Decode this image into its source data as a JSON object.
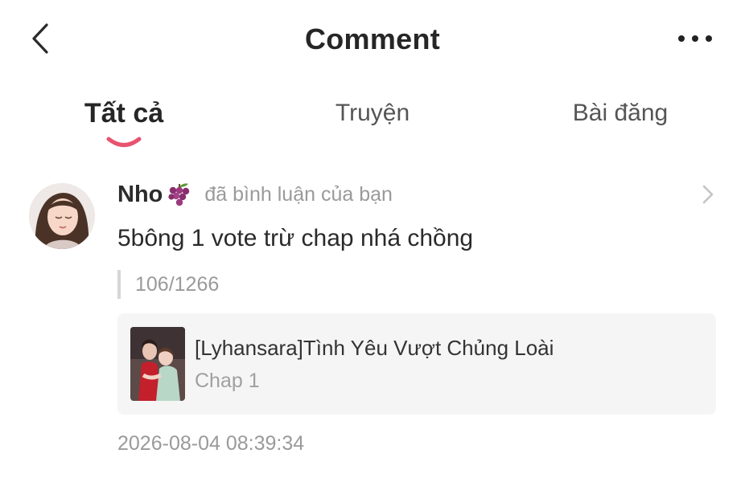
{
  "header": {
    "title": "Comment"
  },
  "tabs": [
    {
      "label": "Tất cả",
      "active": true
    },
    {
      "label": "Truyện",
      "active": false
    },
    {
      "label": "Bài đăng",
      "active": false
    }
  ],
  "colors": {
    "accent": "#e8536f",
    "muted_text": "#9a9a9a",
    "card_bg": "#f5f5f5"
  },
  "comment": {
    "username": "Nho",
    "username_icon": "grape-icon",
    "action": "đã bình luận của bạn",
    "text": "5bông 1 vote trừ chap nhá chồng",
    "quote": "106/1266",
    "story": {
      "title": "[Lyhansara]Tình Yêu Vượt Chủng Loài",
      "chapter": "Chap 1"
    },
    "timestamp": "2026-08-04 08:39:34"
  },
  "icons": {
    "back": "chevron-left-icon",
    "more": "more-dots-icon",
    "open": "chevron-right-icon"
  }
}
